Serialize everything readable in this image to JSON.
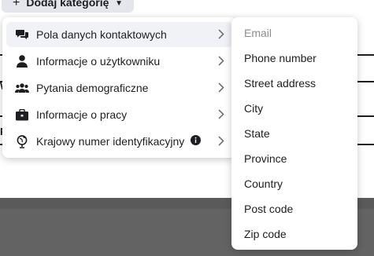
{
  "toolbar": {
    "add_category_label": "Dodaj kategorię",
    "add_category_icon": "plus-icon",
    "caret_icon": "caret-down-icon"
  },
  "background": {
    "letter_1": "W",
    "letter_2": "P",
    "top_color": "#ffffff",
    "bottom_color": "#5a5a5a"
  },
  "menu": {
    "items": [
      {
        "label": "Pola danych kontaktowych",
        "icon": "chat-bubbles-icon",
        "active": true
      },
      {
        "label": "Informacje o użytkowniku",
        "icon": "person-icon",
        "active": false
      },
      {
        "label": "Pytania demograficzne",
        "icon": "group-icon",
        "active": false
      },
      {
        "label": "Informacje o pracy",
        "icon": "briefcase-icon",
        "active": false
      },
      {
        "label": "Krajowy numer identyfikacyjny",
        "icon": "globe-icon",
        "active": false,
        "has_info": true
      }
    ],
    "hover_color": "#f0f2f5"
  },
  "submenu": {
    "items": [
      {
        "label": "Email",
        "disabled": true
      },
      {
        "label": "Phone number"
      },
      {
        "label": "Street address"
      },
      {
        "label": "City"
      },
      {
        "label": "State"
      },
      {
        "label": "Province"
      },
      {
        "label": "Country"
      },
      {
        "label": "Post code"
      },
      {
        "label": "Zip code"
      }
    ],
    "disabled_color": "#8a8d91"
  }
}
